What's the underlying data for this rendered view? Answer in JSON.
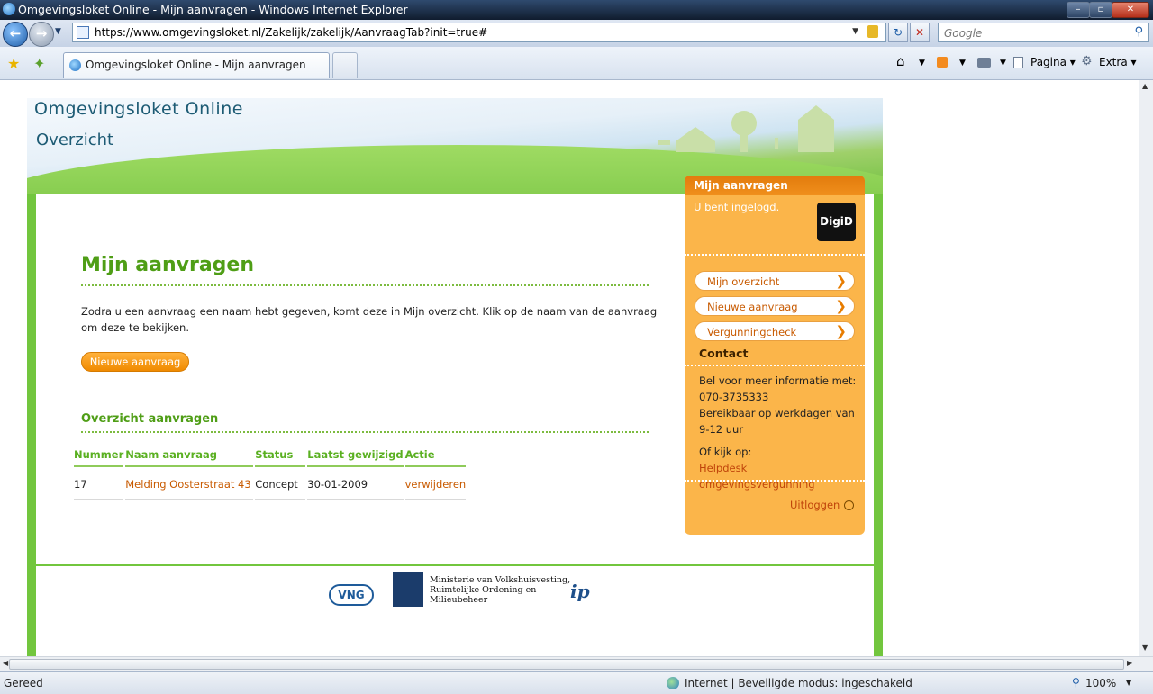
{
  "window": {
    "title": "Omgevingsloket Online - Mijn aanvragen - Windows Internet Explorer",
    "min": "–",
    "max": "▫",
    "close": "✕"
  },
  "browser": {
    "url": "https://www.omgevingsloket.nl/Zakelijk/zakelijk/AanvraagTab?init=true#",
    "search_placeholder": "Google",
    "tab_title": "Omgevingsloket Online - Mijn aanvragen",
    "page_menu": "Pagina",
    "extra_menu": "Extra",
    "status_left": "Gereed",
    "status_zone": "Internet | Beveiligde modus: ingeschakeld",
    "zoom": "100%"
  },
  "site": {
    "name": "Omgevingsloket Online",
    "section": "Overzicht"
  },
  "main": {
    "title": "Mijn aanvragen",
    "intro": "Zodra u een aanvraag een naam hebt gegeven, komt deze in Mijn overzicht. Klik op de naam van de aanvraag om deze te bekijken.",
    "new_button": "Nieuwe aanvraag",
    "overview_title": "Overzicht aanvragen",
    "table": {
      "headers": [
        "Nummer",
        "Naam aanvraag",
        "Status",
        "Laatst gewijzigd",
        "Actie"
      ],
      "rows": [
        {
          "nummer": "17",
          "naam": "Melding Oosterstraat 43",
          "status": "Concept",
          "gewijzigd": "30-01-2009",
          "actie": "verwijderen"
        }
      ]
    }
  },
  "sidebar": {
    "title": "Mijn aanvragen",
    "logged_in": "U bent ingelogd.",
    "digid": "DigiD",
    "links": [
      "Mijn overzicht",
      "Nieuwe aanvraag",
      "Vergunningcheck"
    ],
    "contact_title": "Contact",
    "contact_line1": "Bel voor meer informatie met:",
    "phone": "070-3735333",
    "hours": "Bereikbaar op werkdagen van 9-12 uur",
    "or_look": "Of kijk op:",
    "helpdesk": "Helpdesk omgevingsvergunning",
    "logout": "Uitloggen"
  },
  "footer": {
    "vng": "VNG",
    "ministry_lines": [
      "Ministerie van Volkshuisvesting,",
      "Ruimtelijke Ordening en",
      "Milieubeheer"
    ],
    "ip": "ip"
  }
}
